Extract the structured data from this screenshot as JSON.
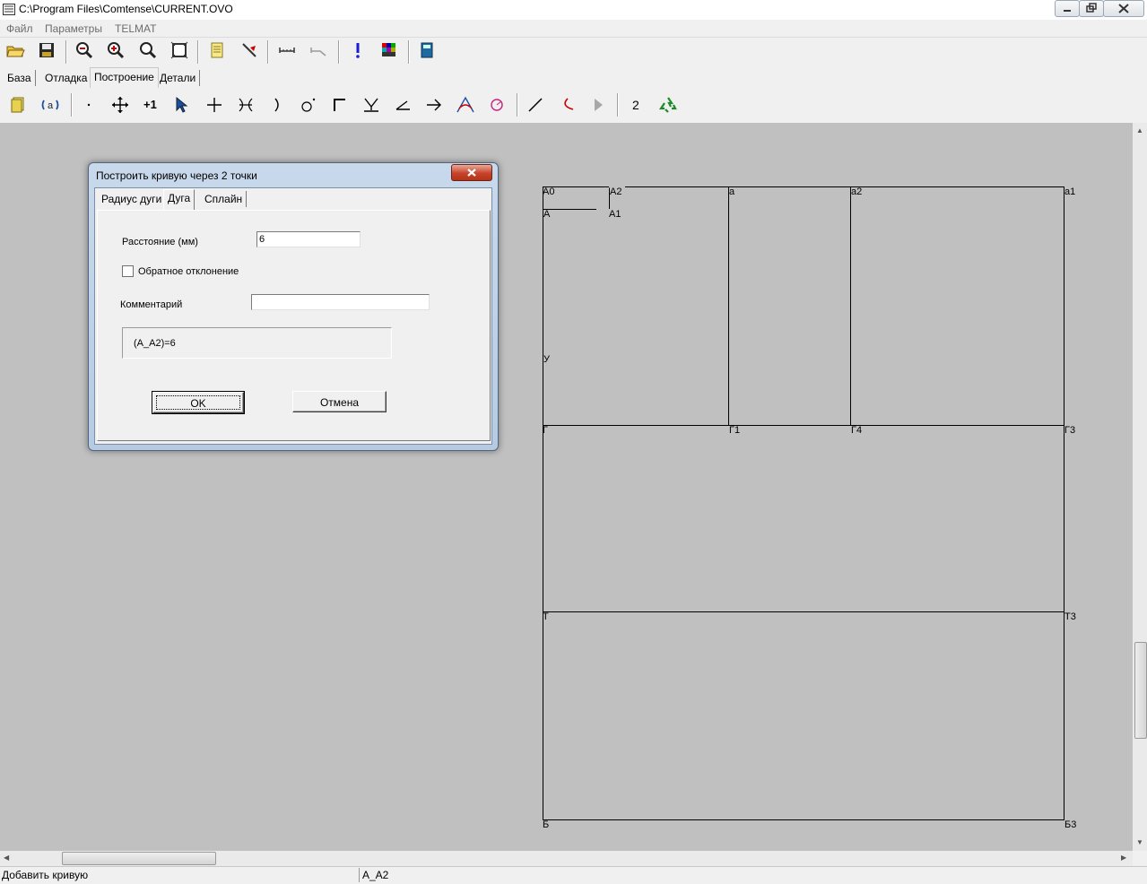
{
  "window": {
    "title": "C:\\Program Files\\Comtense\\CURRENT.OVO"
  },
  "menu": [
    "Файл",
    "Параметры",
    "TELMAT"
  ],
  "toolbar1_icons": [
    "open-icon",
    "save-icon",
    "zoom-out-icon",
    "zoom-in-icon",
    "zoom-icon",
    "fit-window-icon",
    "notes-icon",
    "pin-icon",
    "measure-icon",
    "angle-measure-icon",
    "info-icon",
    "palette-icon",
    "book-icon"
  ],
  "tabs": [
    "База",
    "Отладка",
    "Построение",
    "Детали"
  ],
  "active_tab": "Построение",
  "toolbar2": {
    "text_buttons": {
      "plus_one": "+1",
      "two": "2"
    }
  },
  "drawing": {
    "labels": {
      "A0": "А0",
      "A2": "А2",
      "a": "а",
      "a2": "а2",
      "a1": "а1",
      "A": "А",
      "A1": "А1",
      "U": "У",
      "G": "Г",
      "G1": "Г1",
      "G4": "Г4",
      "G3": "Г3",
      "T": "Т",
      "T3": "Т3",
      "B": "Б",
      "B3": "Б3"
    }
  },
  "dialog": {
    "title": "Построить кривую через 2 точки",
    "tabs": [
      "Радиус дуги",
      "Дуга",
      "Сплайн"
    ],
    "active_tab": "Дуга",
    "distance_label": "Расстояние (мм)",
    "distance_value": "6",
    "reverse_label": "Обратное отклонение",
    "reverse_checked": false,
    "comment_label": "Комментарий",
    "comment_value": "",
    "formula": "(А_А2)=6",
    "ok_label": "OK",
    "cancel_label": "Отмена"
  },
  "status": {
    "left": "Добавить кривую",
    "right": "А_А2"
  }
}
